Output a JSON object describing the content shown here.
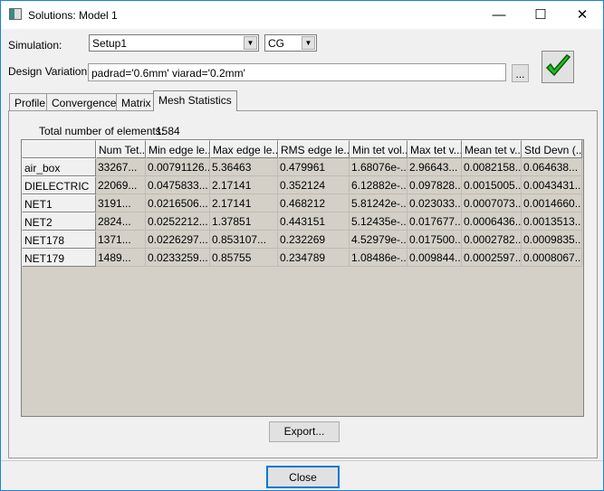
{
  "window": {
    "title": "Solutions:  Model 1",
    "minimize": "—",
    "maximize": "☐",
    "close": "✕"
  },
  "simulation": {
    "label": "Simulation:",
    "value": "Setup1",
    "solver": "CG"
  },
  "design_variation": {
    "label": "Design Variation:",
    "value": "padrad='0.6mm' viarad='0.2mm'",
    "browse": "..."
  },
  "tabs": [
    {
      "label": "Profile"
    },
    {
      "label": "Convergence"
    },
    {
      "label": "Matrix"
    },
    {
      "label": "Mesh Statistics",
      "active": true
    }
  ],
  "mesh": {
    "total_label": "Total number of elements:",
    "total_value": "1584",
    "columns": [
      "",
      "Num Tet...",
      "Min edge le...",
      "Max edge le...",
      "RMS edge le...",
      "Min tet vol...",
      "Max tet v...",
      "Mean tet v...",
      "Std Devn (..."
    ],
    "rows": [
      [
        "air_box",
        "33267...",
        "0.00791126...",
        "5.36463",
        "0.479961",
        "1.68076e-...",
        "2.96643...",
        "0.0082158...",
        "0.064638..."
      ],
      [
        "DIELECTRIC",
        "22069...",
        "0.0475833...",
        "2.17141",
        "0.352124",
        "6.12882e-...",
        "0.097828...",
        "0.0015005...",
        "0.0043431..."
      ],
      [
        "NET1",
        "3191...",
        "0.0216506...",
        "2.17141",
        "0.468212",
        "5.81242e-...",
        "0.023033...",
        "0.0007073...",
        "0.0014660..."
      ],
      [
        "NET2",
        "2824...",
        "0.0252212...",
        "1.37851",
        "0.443151",
        "5.12435e-...",
        "0.017677...",
        "0.0006436...",
        "0.0013513..."
      ],
      [
        "NET178",
        "1371...",
        "0.0226297...",
        "0.853107...",
        "0.232269",
        "4.52979e-...",
        "0.017500...",
        "0.0002782...",
        "0.0009835..."
      ],
      [
        "NET179",
        "1489...",
        "0.0233259...",
        "0.85755",
        "0.234789",
        "1.08486e-...",
        "0.009844...",
        "0.0002597...",
        "0.0008067..."
      ]
    ]
  },
  "export_label": "Export...",
  "close_label": "Close",
  "colors": {
    "accent": "#1883d7",
    "check": "#22c022",
    "grid_bg": "#d4d0c8"
  }
}
